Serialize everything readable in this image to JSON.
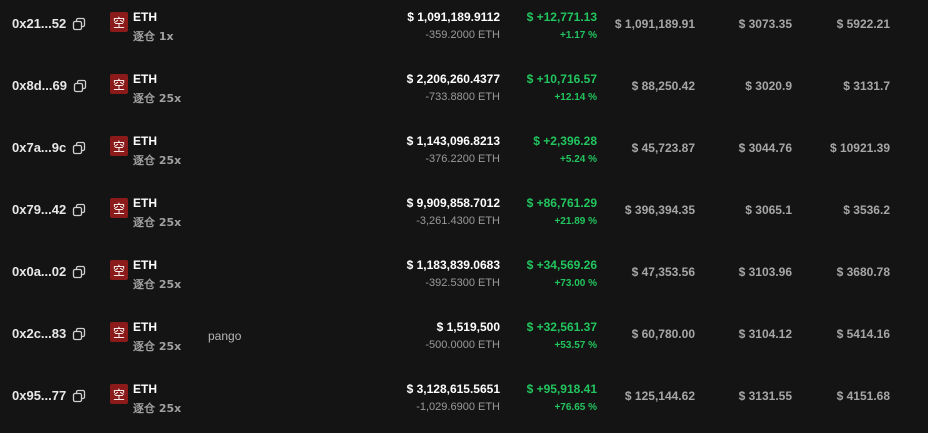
{
  "colors": {
    "background": "#141414",
    "profit": "#22c55e",
    "short_badge": "#8b1a1a",
    "muted": "#a6a6a6"
  },
  "rows": [
    {
      "address": "0x21...52",
      "side": "空",
      "coin": "ETH",
      "leverage": "逐仓 1x",
      "tag": "",
      "value": "$ 1,091,189.9112",
      "size": "-359.2000 ETH",
      "pnl": "$ +12,771.13",
      "pnl_pct": "+1.17 %",
      "margin": "$ 1,091,189.91",
      "entry_price": "$ 3073.35",
      "liq_price": "$ 5922.21"
    },
    {
      "address": "0x8d...69",
      "side": "空",
      "coin": "ETH",
      "leverage": "逐仓 25x",
      "tag": "",
      "value": "$ 2,206,260.4377",
      "size": "-733.8800 ETH",
      "pnl": "$ +10,716.57",
      "pnl_pct": "+12.14 %",
      "margin": "$ 88,250.42",
      "entry_price": "$ 3020.9",
      "liq_price": "$ 3131.7"
    },
    {
      "address": "0x7a...9c",
      "side": "空",
      "coin": "ETH",
      "leverage": "逐仓 25x",
      "tag": "",
      "value": "$ 1,143,096.8213",
      "size": "-376.2200 ETH",
      "pnl": "$ +2,396.28",
      "pnl_pct": "+5.24 %",
      "margin": "$ 45,723.87",
      "entry_price": "$ 3044.76",
      "liq_price": "$ 10921.39"
    },
    {
      "address": "0x79...42",
      "side": "空",
      "coin": "ETH",
      "leverage": "逐仓 25x",
      "tag": "",
      "value": "$ 9,909,858.7012",
      "size": "-3,261.4300 ETH",
      "pnl": "$ +86,761.29",
      "pnl_pct": "+21.89 %",
      "margin": "$ 396,394.35",
      "entry_price": "$ 3065.1",
      "liq_price": "$ 3536.2"
    },
    {
      "address": "0x0a...02",
      "side": "空",
      "coin": "ETH",
      "leverage": "逐仓 25x",
      "tag": "",
      "value": "$ 1,183,839.0683",
      "size": "-392.5300 ETH",
      "pnl": "$ +34,569.26",
      "pnl_pct": "+73.00 %",
      "margin": "$ 47,353.56",
      "entry_price": "$ 3103.96",
      "liq_price": "$ 3680.78"
    },
    {
      "address": "0x2c...83",
      "side": "空",
      "coin": "ETH",
      "leverage": "逐仓 25x",
      "tag": "pango",
      "value": "$ 1,519,500",
      "size": "-500.0000 ETH",
      "pnl": "$ +32,561.37",
      "pnl_pct": "+53.57 %",
      "margin": "$ 60,780.00",
      "entry_price": "$ 3104.12",
      "liq_price": "$ 5414.16"
    },
    {
      "address": "0x95...77",
      "side": "空",
      "coin": "ETH",
      "leverage": "逐仓 25x",
      "tag": "",
      "value": "$ 3,128,615.5651",
      "size": "-1,029.6900 ETH",
      "pnl": "$ +95,918.41",
      "pnl_pct": "+76.65 %",
      "margin": "$ 125,144.62",
      "entry_price": "$ 3131.55",
      "liq_price": "$ 4151.68"
    }
  ]
}
